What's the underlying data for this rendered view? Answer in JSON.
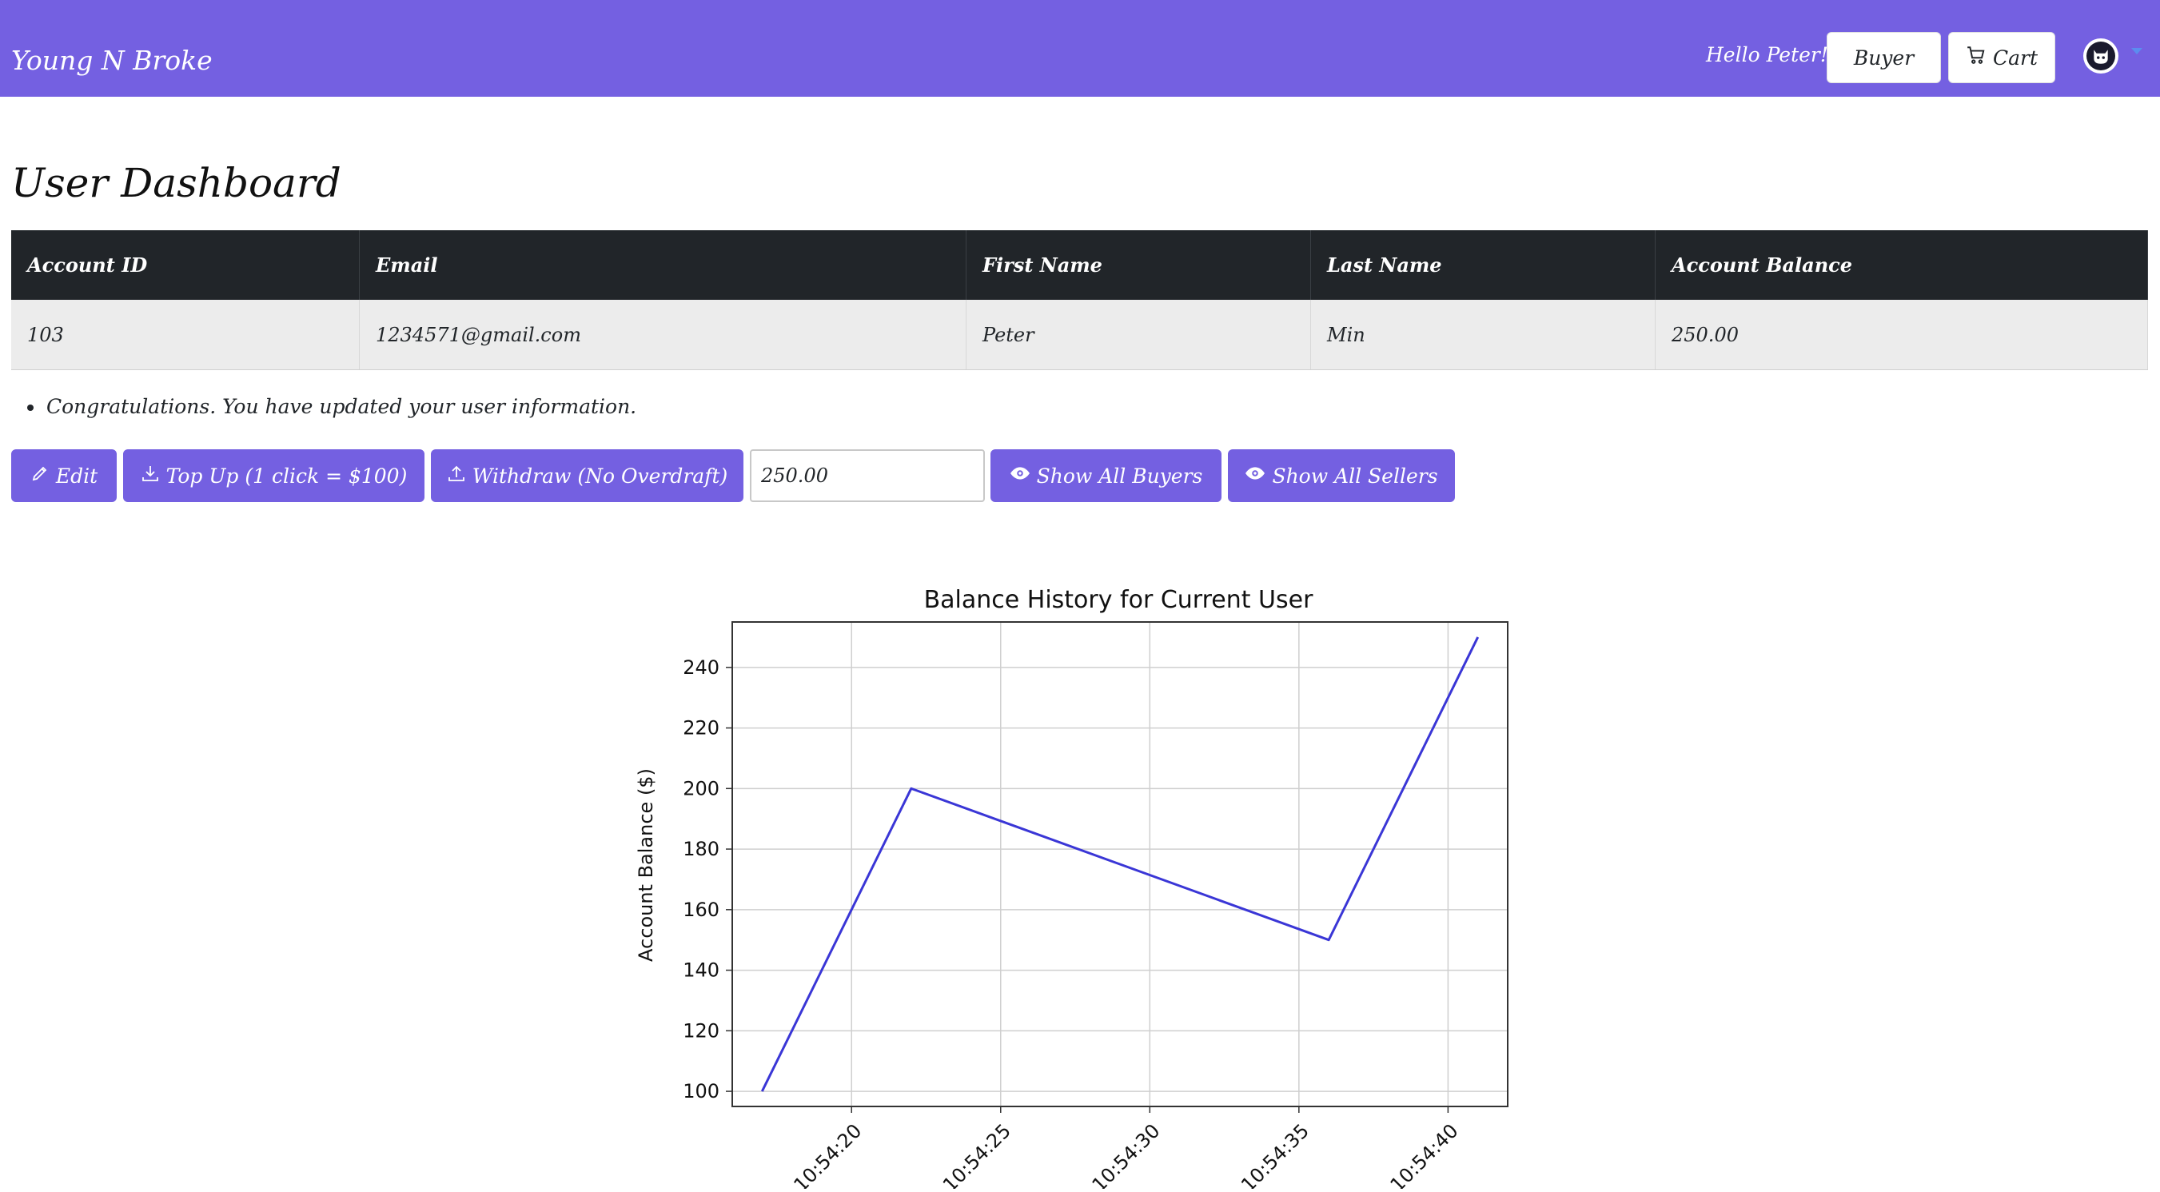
{
  "navbar": {
    "brand": "Young N Broke",
    "greeting": "Hello Peter!",
    "buyer_label": "Buyer",
    "cart_label": "Cart",
    "accent_color": "#7460e1",
    "cart_icon": "cart-icon",
    "avatar_icon": "user-avatar-icon"
  },
  "page": {
    "title": "User Dashboard"
  },
  "table": {
    "headers": [
      "Account ID",
      "Email",
      "First Name",
      "Last Name",
      "Account Balance"
    ],
    "rows": [
      [
        "103",
        "1234571@gmail.com",
        "Peter",
        "Min",
        "250.00"
      ]
    ]
  },
  "message": "Congratulations. You have updated your user information.",
  "actions": {
    "edit_label": "Edit",
    "topup_label": "Top Up (1 click = $100)",
    "withdraw_label": "Withdraw (No Overdraft)",
    "amount_value": "250.00",
    "show_buyers_label": "Show All Buyers",
    "show_sellers_label": "Show All Sellers"
  },
  "chart_data": {
    "type": "line",
    "title": "Balance History for Current User",
    "xlabel": "",
    "ylabel": "Account Balance ($)",
    "x": [
      "10:54:17",
      "10:54:22",
      "10:54:36",
      "10:54:41"
    ],
    "values": [
      100,
      200,
      150,
      250
    ],
    "xticks": [
      "10:54:20",
      "10:54:25",
      "10:54:30",
      "10:54:35",
      "10:54:40"
    ],
    "yticks": [
      100,
      120,
      140,
      160,
      180,
      200,
      220,
      240
    ],
    "xlim": [
      "10:54:16",
      "10:54:42"
    ],
    "ylim": [
      95,
      255
    ],
    "grid": true,
    "line_color": "#3a36d6"
  }
}
